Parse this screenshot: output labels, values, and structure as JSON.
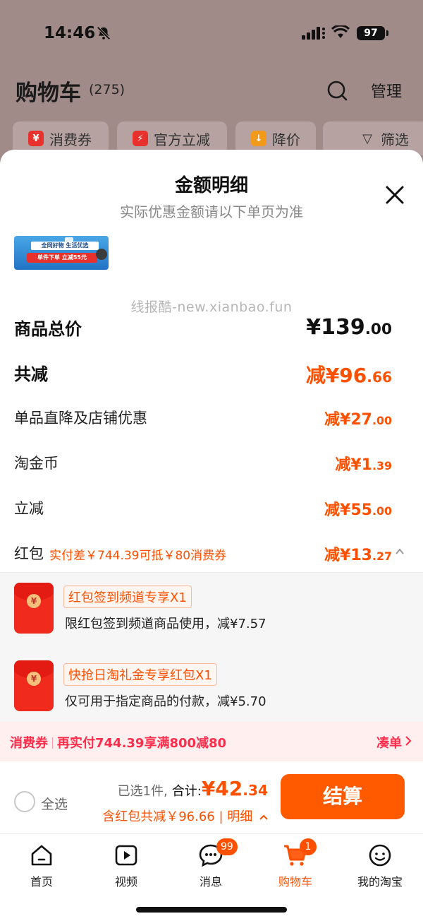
{
  "status_bar": {
    "time": "14:46",
    "battery": "97"
  },
  "cart": {
    "title": "购物车",
    "count": "(275)",
    "manage": "管理"
  },
  "filters": [
    "消费券",
    "官方立减",
    "降价",
    "筛选"
  ],
  "sheet": {
    "title": "金额明细",
    "subtitle": "实际优惠金额请以下单页为准",
    "banner": {
      "line1": "全网好物 生活优选",
      "line2": "单件下单 立减55元"
    },
    "watermark": "线报酷-new.xianbao.fun",
    "rows": [
      {
        "label": "商品总价",
        "value": "¥139",
        "decimal": ".00"
      },
      {
        "label": "共减",
        "value": "减¥96",
        "decimal": ".66"
      },
      {
        "label": "单品直降及店铺优惠",
        "value": "减¥27",
        "decimal": ".00"
      },
      {
        "label": "淘金币",
        "value": "减¥1",
        "decimal": ".39"
      },
      {
        "label": "立减",
        "value": "减¥55",
        "decimal": ".00"
      },
      {
        "label": "红包",
        "note": "实付差￥744.39可抵￥80消费券",
        "value": "减¥13",
        "decimal": ".27"
      }
    ],
    "hongbao": [
      {
        "tag": "红包签到频道专享X1",
        "desc": "限红包签到频道商品使用，减¥7.57"
      },
      {
        "tag": "快抢日淘礼金专享红包X1",
        "desc": "仅可用于指定商品的付款，减¥5.70"
      }
    ],
    "coupon_bar": {
      "label": "消费券",
      "text": "再实付744.39享满800减80",
      "action": "凑单"
    }
  },
  "checkout": {
    "select_all": "全选",
    "selected": "已选1件,",
    "total_label": "合计:",
    "total": "¥42",
    "total_decimal": ".34",
    "saving": "含红包共减￥96.66 | 明细",
    "pay": "结算"
  },
  "tabs": [
    {
      "label": "首页",
      "icon": "home-icon"
    },
    {
      "label": "视频",
      "icon": "video-icon"
    },
    {
      "label": "消息",
      "icon": "message-icon",
      "badge": "99"
    },
    {
      "label": "购物车",
      "icon": "cart-icon",
      "badge": "1",
      "active": true
    },
    {
      "label": "我的淘宝",
      "icon": "profile-icon"
    }
  ],
  "colors": {
    "accent": "#ff5000",
    "coupon": "#ff2d4c"
  }
}
